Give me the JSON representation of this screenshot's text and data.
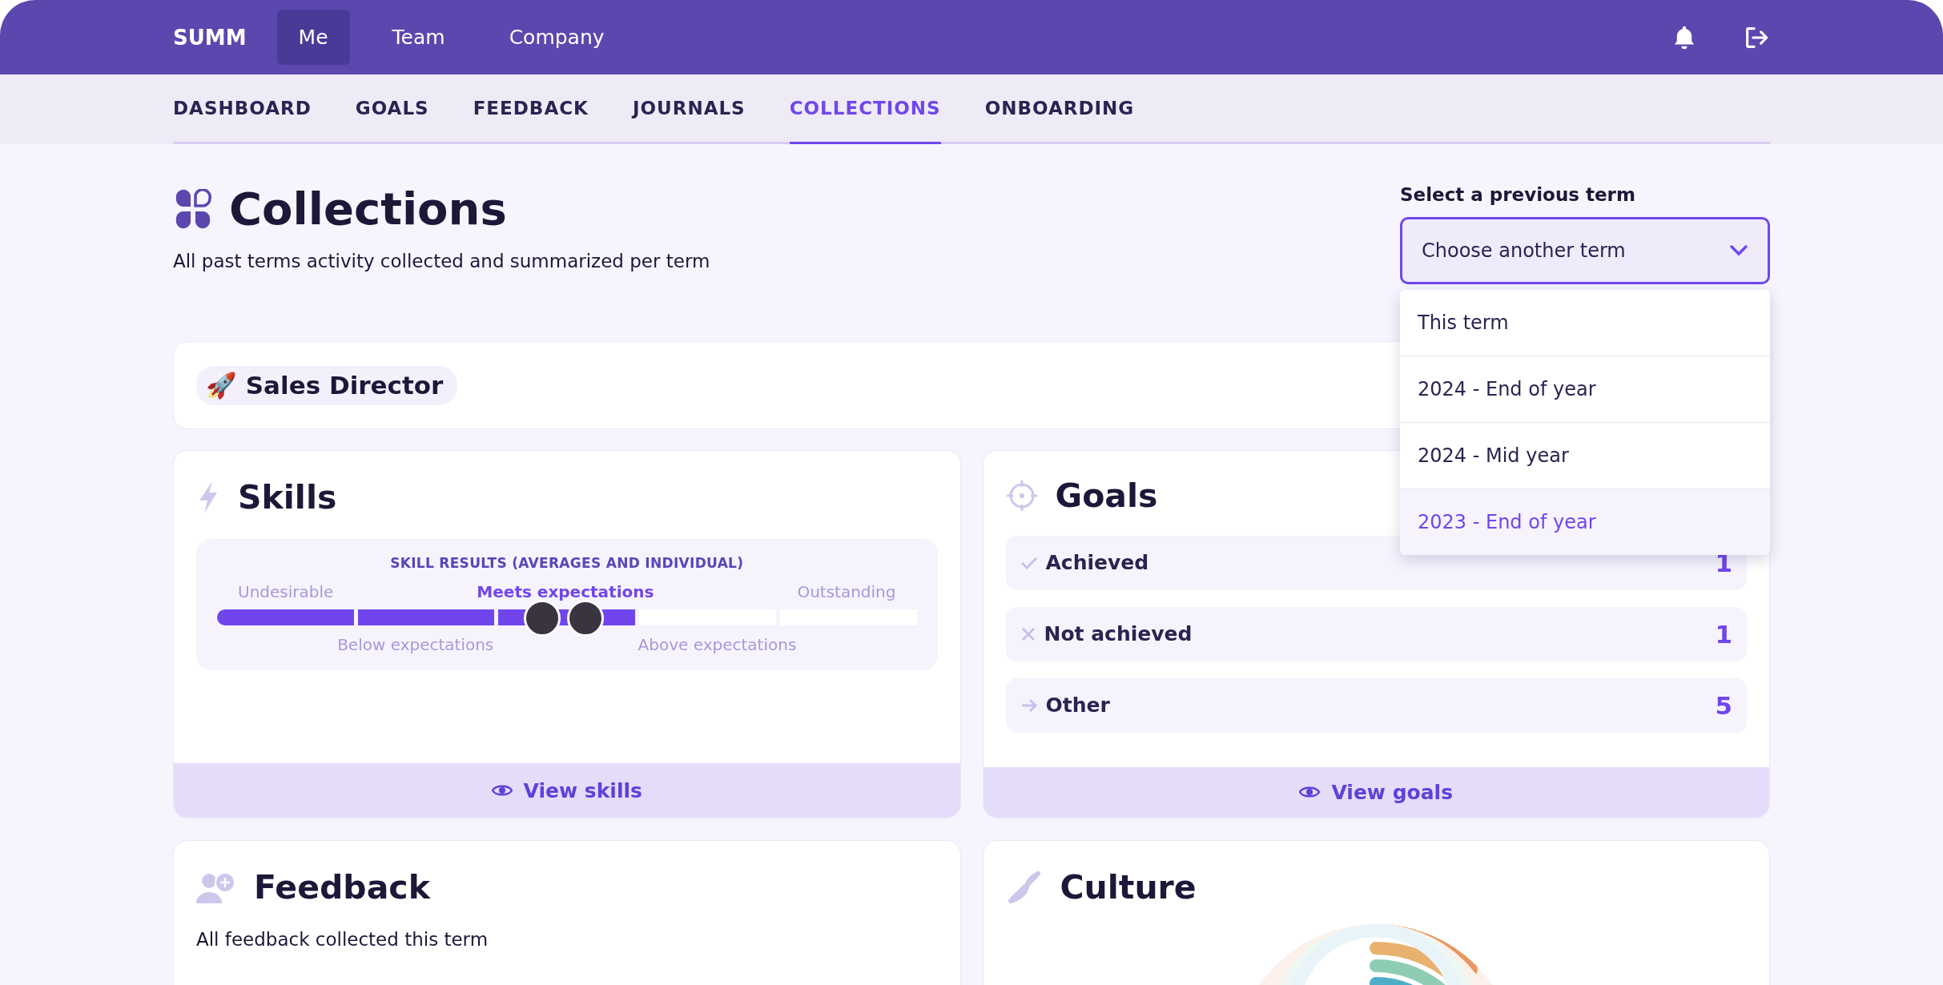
{
  "top_nav": {
    "logo": "SUMM",
    "items": [
      {
        "label": "Me",
        "selected": true
      },
      {
        "label": "Team",
        "selected": false
      },
      {
        "label": "Company",
        "selected": false
      }
    ]
  },
  "sub_nav": {
    "tabs": [
      {
        "label": "DASHBOARD",
        "selected": false
      },
      {
        "label": "GOALS",
        "selected": false
      },
      {
        "label": "FEEDBACK",
        "selected": false
      },
      {
        "label": "JOURNALS",
        "selected": false
      },
      {
        "label": "COLLECTIONS",
        "selected": true
      },
      {
        "label": "ONBOARDING",
        "selected": false
      }
    ]
  },
  "page": {
    "title": "Collections",
    "subtitle": "All past terms activity collected and summarized per term"
  },
  "term_select": {
    "label": "Select a previous term",
    "placeholder": "Choose another term",
    "expanded": true,
    "options": [
      {
        "label": "This term",
        "selected": false
      },
      {
        "label": "2024 - End of year",
        "selected": false
      },
      {
        "label": "2024 - Mid year",
        "selected": false
      },
      {
        "label": "2023 - End of year",
        "selected": true
      }
    ]
  },
  "role": {
    "emoji": "🚀",
    "title": "Sales Director"
  },
  "skills": {
    "title": "Skills",
    "panel_title": "SKILL RESULTS (AVERAGES AND INDIVIDUAL)",
    "upper_labels": [
      {
        "label": "Undesirable",
        "selected": false
      },
      {
        "label": "Meets expectations",
        "selected": true
      },
      {
        "label": "Outstanding",
        "selected": false
      }
    ],
    "segments": [
      {
        "filled": true
      },
      {
        "filled": true
      },
      {
        "filled": true
      },
      {
        "filled": false
      },
      {
        "filled": false
      }
    ],
    "avatars": [
      {
        "level": 0.465
      },
      {
        "level": 0.527
      }
    ],
    "lower_labels": [
      {
        "label": "Below expectations",
        "selected": false
      },
      {
        "label": "Above expectations",
        "selected": false
      }
    ],
    "footer": "View skills"
  },
  "goals": {
    "title": "Goals",
    "rows": [
      {
        "kind": "achieved",
        "label": "Achieved",
        "count": "1"
      },
      {
        "kind": "not_achieved",
        "label": "Not achieved",
        "count": "1"
      },
      {
        "kind": "other",
        "label": "Other",
        "count": "5"
      }
    ],
    "footer": "View goals"
  },
  "feedback": {
    "title": "Feedback",
    "subtitle": "All feedback collected this term"
  },
  "culture": {
    "title": "Culture"
  }
}
